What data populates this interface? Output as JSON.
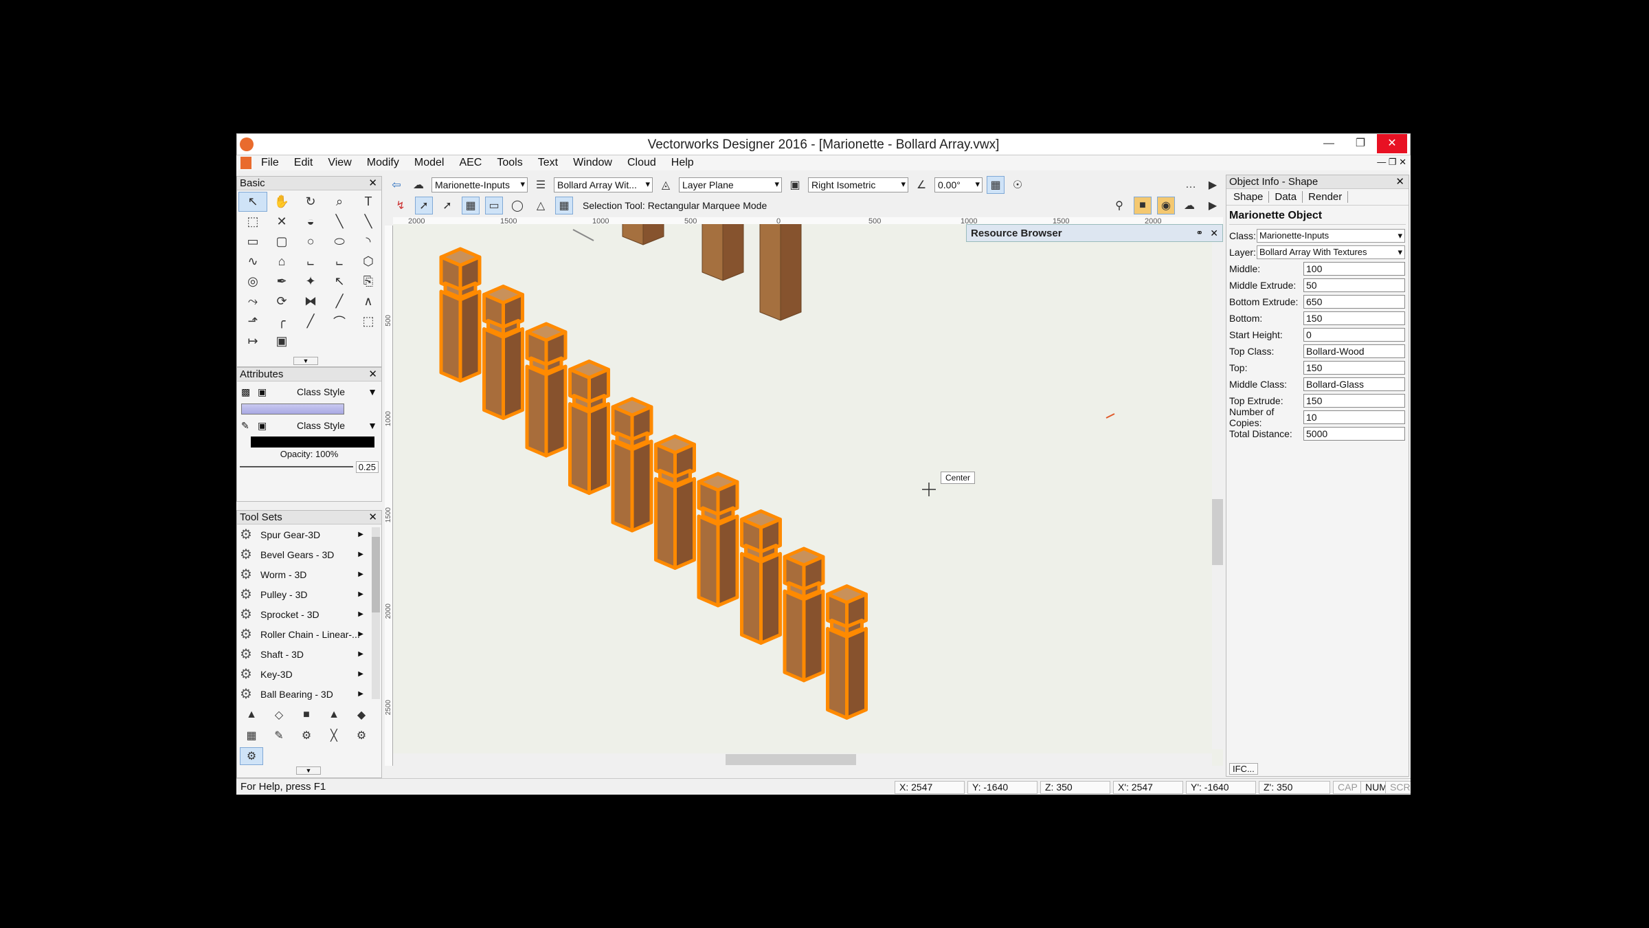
{
  "window": {
    "title": "Vectorworks Designer 2016 - [Marionette - Bollard Array.vwx]"
  },
  "menu": [
    "File",
    "Edit",
    "View",
    "Modify",
    "Model",
    "AEC",
    "Tools",
    "Text",
    "Window",
    "Cloud",
    "Help"
  ],
  "view_bar": {
    "class": "Marionette-Inputs",
    "layer": "Bollard Array Wit...",
    "plane": "Layer Plane",
    "view": "Right Isometric",
    "angle": "0.00°"
  },
  "mode_bar": {
    "hint": "Selection Tool: Rectangular Marquee Mode"
  },
  "basic_palette": {
    "title": "Basic",
    "tools": [
      "arrow-tool-icon",
      "pan-tool-icon",
      "flyover-icon",
      "zoom-icon",
      "text-tool-icon",
      "marquee-icon",
      "delete-icon",
      "attribute-icon",
      "line-icon",
      "double-line-icon",
      "rectangle-icon",
      "rounded-rect-icon",
      "circle-icon",
      "oval-icon",
      "arc-icon",
      "freehand-icon",
      "polygon-icon",
      "polyline-icon",
      "double-polyline-icon",
      "regular-polygon-icon",
      "spiral-icon",
      "eyedropper-icon",
      "magic-wand-icon",
      "select-similar-icon",
      "clip-icon",
      "reshape-icon",
      "rotate-icon",
      "mirror-icon",
      "split-icon",
      "trim-icon",
      "offset-icon",
      "fillet-icon",
      "chamfer-icon",
      "connect-icon",
      "move-icon",
      "dimension-icon",
      "symbol-icon"
    ]
  },
  "attributes": {
    "title": "Attributes",
    "fill_label": "Class Style",
    "pen_label": "Class Style",
    "opacity": "Opacity: 100%",
    "line_weight": "0.25"
  },
  "toolsets": {
    "title": "Tool Sets",
    "items": [
      "Spur Gear-3D",
      "Bevel Gears - 3D",
      "Worm - 3D",
      "Pulley - 3D",
      "Sprocket - 3D",
      "Roller Chain - Linear-...",
      "Shaft - 3D",
      "Key-3D",
      "Ball Bearing - 3D"
    ]
  },
  "ruler": {
    "top": [
      "2000",
      "1500",
      "1000",
      "500",
      "0",
      "500",
      "1000",
      "1500",
      "2000"
    ],
    "left": [
      "500",
      "1000",
      "1500",
      "2000",
      "2500"
    ]
  },
  "resource_browser": {
    "title": "Resource Browser"
  },
  "snap_tip": "Center",
  "object_info": {
    "title": "Object Info - Shape",
    "tabs": [
      "Shape",
      "Data",
      "Render"
    ],
    "heading": "Marionette Object",
    "class_label": "Class:",
    "class_value": "Marionette-Inputs",
    "layer_label": "Layer:",
    "layer_value": "Bollard Array With Textures",
    "fields": [
      {
        "label": "Middle:",
        "value": "100"
      },
      {
        "label": "Middle Extrude:",
        "value": "50"
      },
      {
        "label": "Bottom Extrude:",
        "value": "650"
      },
      {
        "label": "Bottom:",
        "value": "150"
      },
      {
        "label": "Start Height:",
        "value": "0"
      },
      {
        "label": "Top Class:",
        "value": "Bollard-Wood"
      },
      {
        "label": "Top:",
        "value": "150"
      },
      {
        "label": "Middle Class:",
        "value": "Bollard-Glass"
      },
      {
        "label": "Top Extrude:",
        "value": "150"
      },
      {
        "label": "Number of Copies:",
        "value": "10"
      },
      {
        "label": "Total Distance:",
        "value": "5000"
      }
    ],
    "ifc": "IFC..."
  },
  "status": {
    "help": "For Help, press F1",
    "x": "X: 2547",
    "y": "Y: -1640",
    "z": "Z: 350",
    "x2": "X': 2547",
    "y2": "Y': -1640",
    "z2": "Z': 350",
    "cap": "CAP",
    "num": "NUM",
    "scrl": "SCRL"
  },
  "colors": {
    "selection": "#ff8a00",
    "wood": "#a0673a",
    "canvas": "#eef0e9"
  }
}
